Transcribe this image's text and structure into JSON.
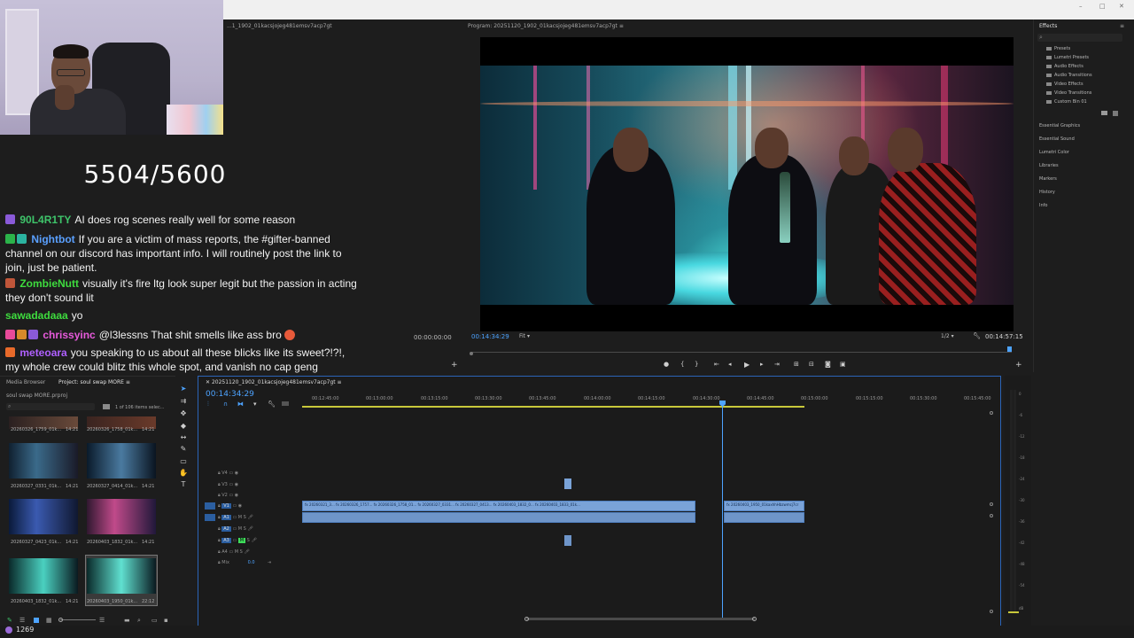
{
  "window": {
    "minimize": "–",
    "maximize": "□",
    "close": "✕"
  },
  "counter": "5504/5600",
  "chat": [
    {
      "user": "90L4R1TY",
      "color": "#3ec46a",
      "message": "AI does rog scenes really well for some reason"
    },
    {
      "user": "Nightbot",
      "color": "#5aa0ff",
      "message": "If you are a victim of mass reports, the #gifter-banned channel on our discord has important info. I will routinely post the link to join, just be patient."
    },
    {
      "user": "ZombieNutt",
      "color": "#3edc3e",
      "message": "visually it's fire ltg look super legit but the passion in acting they don't sound lit"
    },
    {
      "user": "sawadadaaa",
      "color": "#3edc3e",
      "message": "yo"
    },
    {
      "user": "chrissyinc",
      "color": "#e85adc",
      "message": "@l3lessns That shit smells like ass bro"
    },
    {
      "user": "meteoara",
      "color": "#b060ff",
      "message": "you speaking to us about all these blicks like its sweet?!?!, my whole crew could blitz this whole spot, and vanish no cap geng"
    }
  ],
  "source_monitor": {
    "title": "...1_1902_01kacsjojeg481emsv7acp7gt",
    "timecode": "00:00:00:00"
  },
  "program_monitor": {
    "title": "Program: 20251120_1902_01kacsjojeg481emsv7acp7gt",
    "menu_icon": "≡",
    "timecode": "00:14:34:29",
    "fit": "Fit",
    "ratio": "1/2",
    "duration": "00:14:57:15"
  },
  "effects": {
    "title": "Effects",
    "items": [
      "Presets",
      "Lumetri Presets",
      "Audio Effects",
      "Audio Transitions",
      "Video Effects",
      "Video Transitions",
      "Custom Bin 01"
    ],
    "panels": [
      "Essential Graphics",
      "Essential Sound",
      "Lumetri Color",
      "Libraries",
      "Markers",
      "History",
      "Info"
    ]
  },
  "project": {
    "tab_media_browser": "Media Browser",
    "tab_project": "Project: soul swap MORE",
    "file": "soul swap MORE.prproj",
    "items_selected": "1 of 106 items selec...",
    "thumbnails": [
      {
        "name": "20260326_1759_01k...",
        "duration": "14:21"
      },
      {
        "name": "20260326_1758_01k...",
        "duration": "14:21"
      },
      {
        "name": "20260327_0331_01k...",
        "duration": "14:21"
      },
      {
        "name": "20260327_0414_01k...",
        "duration": "14:21"
      },
      {
        "name": "20260327_0423_01k...",
        "duration": "14:21"
      },
      {
        "name": "20260403_1832_01k...",
        "duration": "14:21"
      },
      {
        "name": "20260403_1832_01k...",
        "duration": "14:21"
      },
      {
        "name": "20260403_1950_01k...",
        "duration": "22:12"
      }
    ]
  },
  "timeline": {
    "tab": "20251120_1902_01kacsjojeg481emsv7acp7gt",
    "timecode": "00:14:34:29",
    "ruler": [
      "00:12:45:00",
      "00:13:00:00",
      "00:13:15:00",
      "00:13:30:00",
      "00:13:45:00",
      "00:14:00:00",
      "00:14:15:00",
      "00:14:30:00",
      "00:14:45:00",
      "00:15:00:00",
      "00:15:15:00",
      "00:15:30:00",
      "00:15:45:00"
    ],
    "video_tracks": [
      "V4",
      "V3",
      "V2",
      "V1"
    ],
    "audio_tracks": [
      "A1",
      "A2",
      "A3",
      "A4"
    ],
    "mix_label": "Mix",
    "mix_value": "0.0"
  },
  "meters": [
    "0",
    "-6",
    "-12",
    "-18",
    "-24",
    "-30",
    "-36",
    "-42",
    "-48",
    "-54",
    "dB"
  ],
  "status": {
    "viewers": "1269"
  }
}
